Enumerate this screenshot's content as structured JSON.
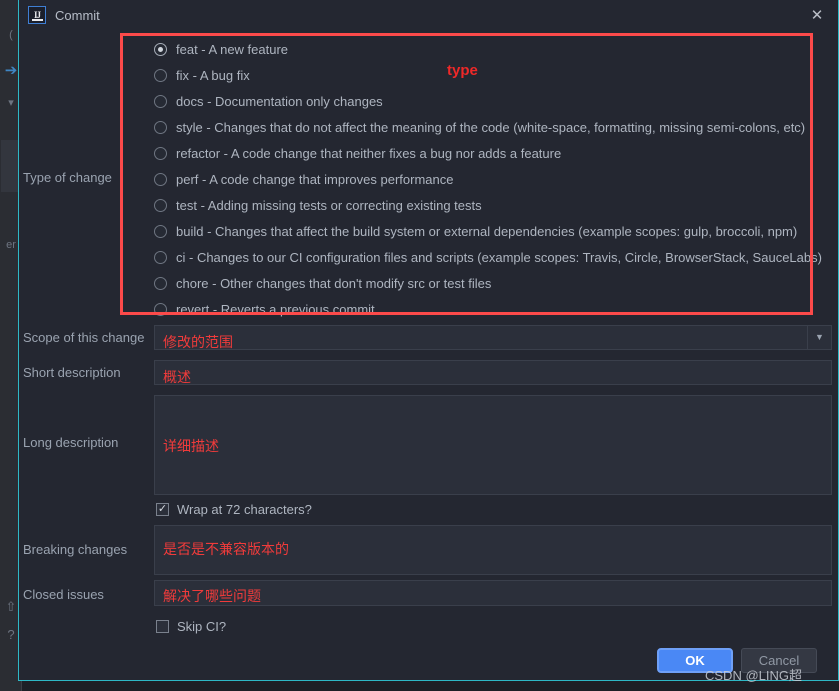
{
  "window": {
    "title": "Commit",
    "logo_text": "IJ",
    "close_icon": "✕"
  },
  "annotations": {
    "type_label": "type"
  },
  "type_of_change": {
    "label": "Type of change",
    "selected": "feat",
    "options": [
      {
        "value": "feat",
        "label": "feat - A new feature"
      },
      {
        "value": "fix",
        "label": "fix - A bug fix"
      },
      {
        "value": "docs",
        "label": "docs - Documentation only changes"
      },
      {
        "value": "style",
        "label": "style - Changes that do not affect the meaning of the code (white-space, formatting, missing semi-colons, etc)"
      },
      {
        "value": "refactor",
        "label": "refactor - A code change that neither fixes a bug nor adds a feature"
      },
      {
        "value": "perf",
        "label": "perf - A code change that improves performance"
      },
      {
        "value": "test",
        "label": "test - Adding missing tests or correcting existing tests"
      },
      {
        "value": "build",
        "label": "build - Changes that affect the build system or external dependencies (example scopes: gulp, broccoli, npm)"
      },
      {
        "value": "ci",
        "label": "ci - Changes to our CI configuration files and scripts (example scopes: Travis, Circle, BrowserStack, SauceLabs)"
      },
      {
        "value": "chore",
        "label": "chore - Other changes that don't modify src or test files"
      },
      {
        "value": "revert",
        "label": "revert - Reverts a previous commit"
      }
    ]
  },
  "scope": {
    "label": "Scope of this change",
    "value": "修改的范围",
    "dropdown_icon": "▼"
  },
  "short_description": {
    "label": "Short description",
    "value": "概述"
  },
  "long_description": {
    "label": "Long description",
    "value": "详细描述"
  },
  "wrap": {
    "label": "Wrap at 72 characters?",
    "checked": true,
    "check_glyph": "✓"
  },
  "breaking_changes": {
    "label": "Breaking changes",
    "value": "是否是不兼容版本的"
  },
  "closed_issues": {
    "label": "Closed issues",
    "value": "解决了哪些问题"
  },
  "skip_ci": {
    "label": "Skip CI?",
    "checked": false,
    "check_glyph": ""
  },
  "buttons": {
    "ok": "OK",
    "cancel": "Cancel"
  },
  "watermark": "CSDN @LING超",
  "colors": {
    "accent_border": "#2eb8c6",
    "annotation_red": "#f03b3b",
    "box_red": "#fc4a4a",
    "ok_blue": "#4a88f5",
    "panel": "#242731",
    "field": "#2b2f3a",
    "label_text": "#9aa3b0"
  }
}
